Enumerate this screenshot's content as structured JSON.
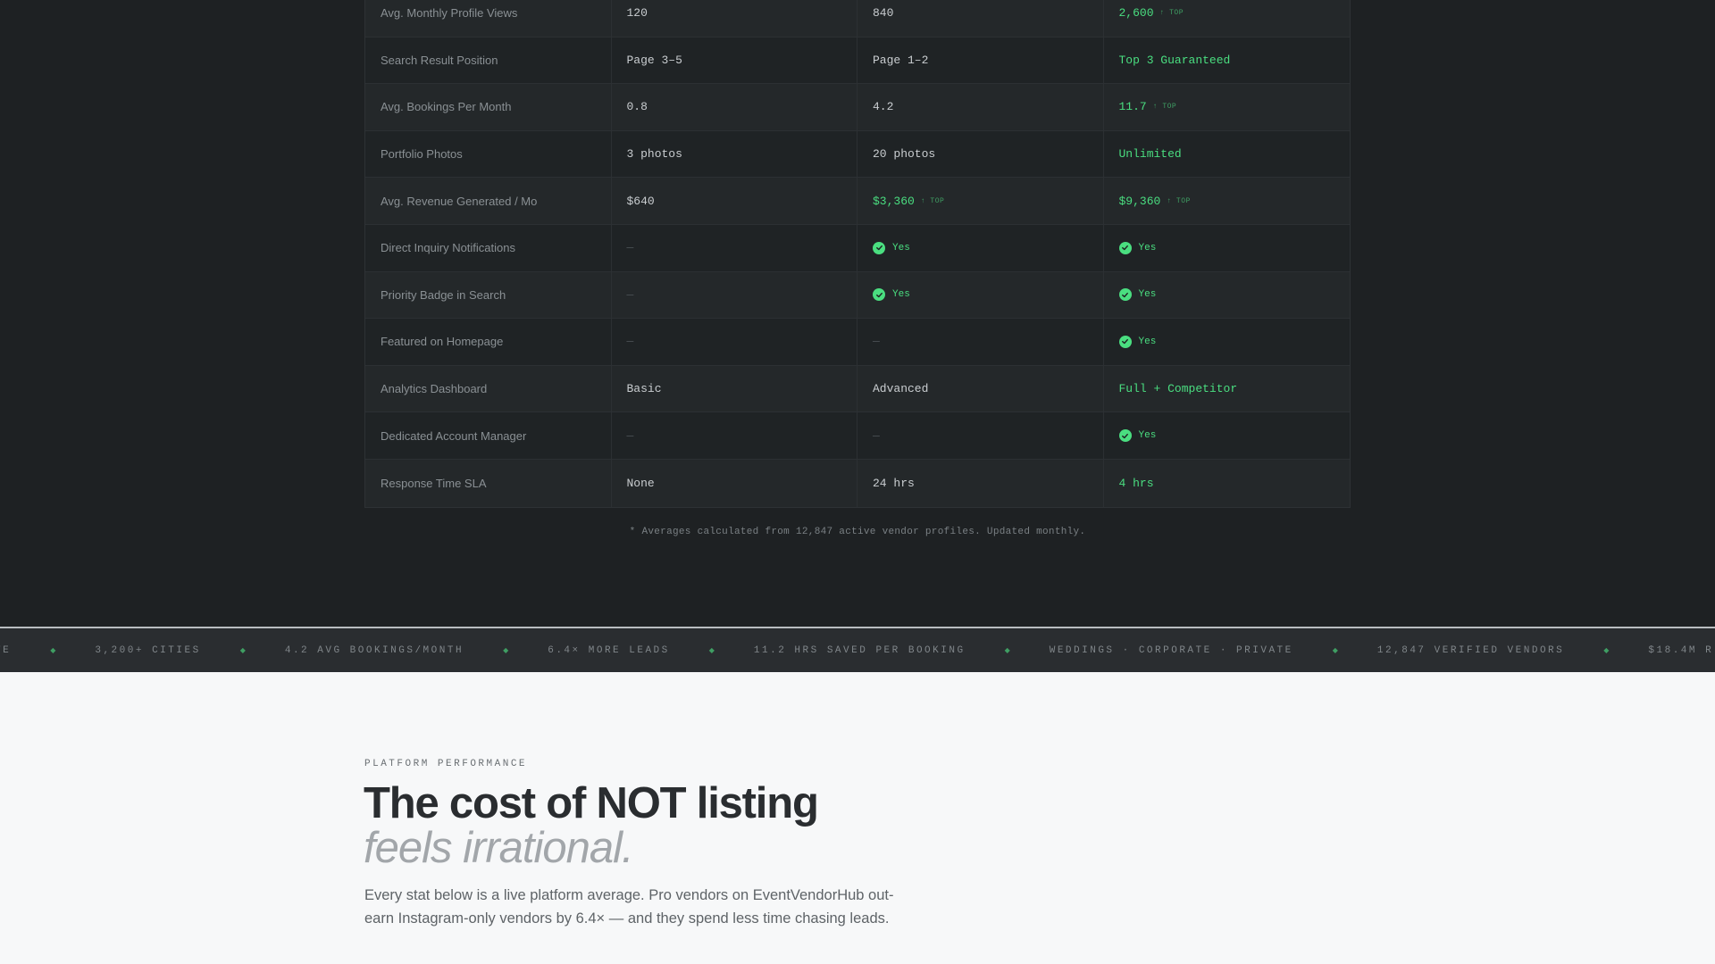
{
  "comparison_table": {
    "rows": [
      {
        "label": "Avg. Monthly Profile Views",
        "values": [
          {
            "text": "120"
          },
          {
            "text": "840"
          },
          {
            "text": "2,600",
            "green": true,
            "tag": "↑ TOP"
          }
        ]
      },
      {
        "label": "Search Result Position",
        "values": [
          {
            "text": "Page 3–5"
          },
          {
            "text": "Page 1–2"
          },
          {
            "text": "Top 3 Guaranteed",
            "green": true
          }
        ]
      },
      {
        "label": "Avg. Bookings Per Month",
        "values": [
          {
            "text": "0.8"
          },
          {
            "text": "4.2"
          },
          {
            "text": "11.7",
            "green": true,
            "tag": "↑ TOP"
          }
        ]
      },
      {
        "label": "Portfolio Photos",
        "values": [
          {
            "text": "3 photos"
          },
          {
            "text": "20 photos"
          },
          {
            "text": "Unlimited",
            "green": true
          }
        ]
      },
      {
        "label": "Avg. Revenue Generated / Mo",
        "values": [
          {
            "text": "$640"
          },
          {
            "text": "$3,360",
            "green": true,
            "tag": "↑ TOP"
          },
          {
            "text": "$9,360",
            "green": true,
            "tag": "↑ TOP"
          }
        ]
      },
      {
        "label": "Direct Inquiry Notifications",
        "values": [
          {
            "text": "—",
            "dash": true
          },
          {
            "text": "Yes",
            "yes": true
          },
          {
            "text": "Yes",
            "yes": true
          }
        ]
      },
      {
        "label": "Priority Badge in Search",
        "values": [
          {
            "text": "—",
            "dash": true
          },
          {
            "text": "Yes",
            "yes": true
          },
          {
            "text": "Yes",
            "yes": true
          }
        ]
      },
      {
        "label": "Featured on Homepage",
        "values": [
          {
            "text": "—",
            "dash": true
          },
          {
            "text": "—",
            "dash": true
          },
          {
            "text": "Yes",
            "yes": true
          }
        ]
      },
      {
        "label": "Analytics Dashboard",
        "values": [
          {
            "text": "Basic"
          },
          {
            "text": "Advanced"
          },
          {
            "text": "Full + Competitor",
            "green": true
          }
        ]
      },
      {
        "label": "Dedicated Account Manager",
        "values": [
          {
            "text": "—",
            "dash": true
          },
          {
            "text": "—",
            "dash": true
          },
          {
            "text": "Yes",
            "yes": true
          }
        ]
      },
      {
        "label": "Response Time SLA",
        "values": [
          {
            "text": "None"
          },
          {
            "text": "24 hrs"
          },
          {
            "text": "4 hrs",
            "green": true
          }
        ]
      }
    ],
    "footnote": "* Averages calculated from 12,847 active vendor profiles. Updated monthly."
  },
  "ticker": {
    "items": [
      "TE",
      "3,200+ CITIES",
      "4.2 AVG BOOKINGS/MONTH",
      "6.4× MORE LEADS",
      "11.2 HRS SAVED PER BOOKING",
      "WEDDINGS · CORPORATE · PRIVATE",
      "12,847 VERIFIED VENDORS",
      "$18.4M R"
    ],
    "separator": "◆"
  },
  "section": {
    "eyebrow": "PLATFORM PERFORMANCE",
    "headline": "The cost of NOT listing",
    "headline_italic": "feels irrational.",
    "lead": "Every stat below is a live platform average. Pro vendors on EventVendorHub out-earn Instagram-only vendors by 6.4× — and they spend less time chasing leads."
  },
  "colors": {
    "dark_bg": "#1e2123",
    "accent_green": "#4ade80",
    "light_bg": "#f7f8f9"
  }
}
